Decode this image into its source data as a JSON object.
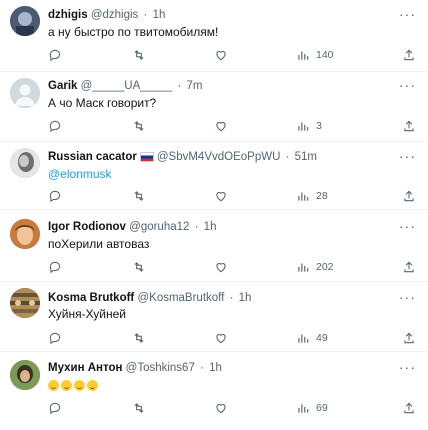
{
  "tweets": [
    {
      "name": "dzhigis",
      "handle": "@dzhigis",
      "time": "1h",
      "text": "а ну быстро по твитомобилям!",
      "views": "140",
      "avatar_bg": "#7b8aa3"
    },
    {
      "name": "Garik",
      "handle": "@_____UA_____",
      "time": "7m",
      "text": "А чо Маск говорит?",
      "views": "3",
      "avatar_bg": "#cfd9de"
    },
    {
      "name": "Russian cacator",
      "handle": "@SbvM4VvdOEoPpWU",
      "time": "51m",
      "text": "@elonmusk",
      "views": "28",
      "avatar_bg": "#b9b9b9"
    },
    {
      "name": "Igor Rodionov",
      "handle": "@goruha12",
      "time": "1h",
      "text": "поХерили автоваз",
      "views": "202",
      "avatar_bg": "#d68a52"
    },
    {
      "name": "Kosma Brutkoff",
      "handle": "@KosmaBrutkoff",
      "time": "1h",
      "text": "Хуйня-Хуйней",
      "views": "49",
      "avatar_bg": "#8a6a3f"
    },
    {
      "name": "Мухин Антон",
      "handle": "@Toshkins67",
      "time": "1h",
      "text": "",
      "emoji_count": 4,
      "views": "69",
      "avatar_bg": "#6b8a4a"
    }
  ],
  "icons": {
    "reply": "reply-icon",
    "retweet": "retweet-icon",
    "like": "like-icon",
    "views": "views-icon",
    "more": "more-icon"
  },
  "colors": {
    "link": "#1d9bf0",
    "muted": "#536471",
    "text": "#0f1419"
  }
}
